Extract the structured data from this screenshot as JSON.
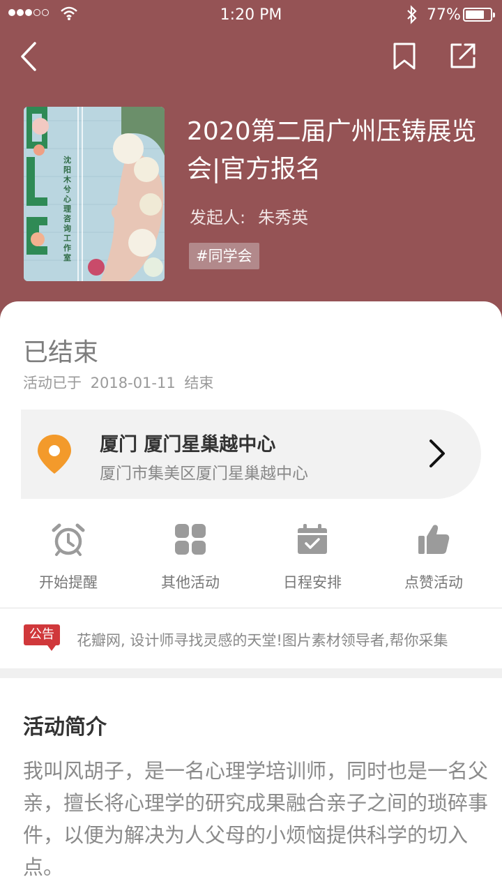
{
  "status_bar": {
    "time": "1:20 PM",
    "battery": "77%",
    "signal_level": "3 of 5",
    "battery_level": 0.77
  },
  "nav": {
    "back_icon": "chevron-left-icon",
    "bookmark_icon": "bookmark-icon",
    "share_icon": "share-icon"
  },
  "event": {
    "title": "2020第二届广州压铸展览会|官方报名",
    "organizer_label": "发起人:",
    "organizer_name": "朱秀英",
    "tag": "#同学会",
    "cover_text": "沈阳木兮心理咨询工作室"
  },
  "status": {
    "title": "已结束",
    "subtitle": "活动已于 2018-01-11 结束"
  },
  "location": {
    "title": "厦门 厦门星巢越中心",
    "address": "厦门市集美区厦门星巢越中心"
  },
  "actions": [
    {
      "label": "开始提醒",
      "icon": "alarm-clock-icon"
    },
    {
      "label": "其他活动",
      "icon": "grid-icon"
    },
    {
      "label": "日程安排",
      "icon": "calendar-icon"
    },
    {
      "label": "点赞活动",
      "icon": "thumbs-up-icon"
    }
  ],
  "notice": {
    "badge": "公告",
    "text": "花瓣网, 设计师寻找灵感的天堂!图片素材领导者,帮你采集"
  },
  "intro": {
    "title": "活动简介",
    "text": "我叫风胡子，是一名心理学培训师，同时也是一名父亲，擅长将心理学的研究成果融合亲子之间的琐碎事件，以便为解决为人父母的小烦恼提供科学的切入点。"
  },
  "colors": {
    "header_bg": "#955355",
    "notice_badge": "#d0383b",
    "location_pin": "#f39a2b",
    "icon_gray": "#9b9b9b"
  }
}
